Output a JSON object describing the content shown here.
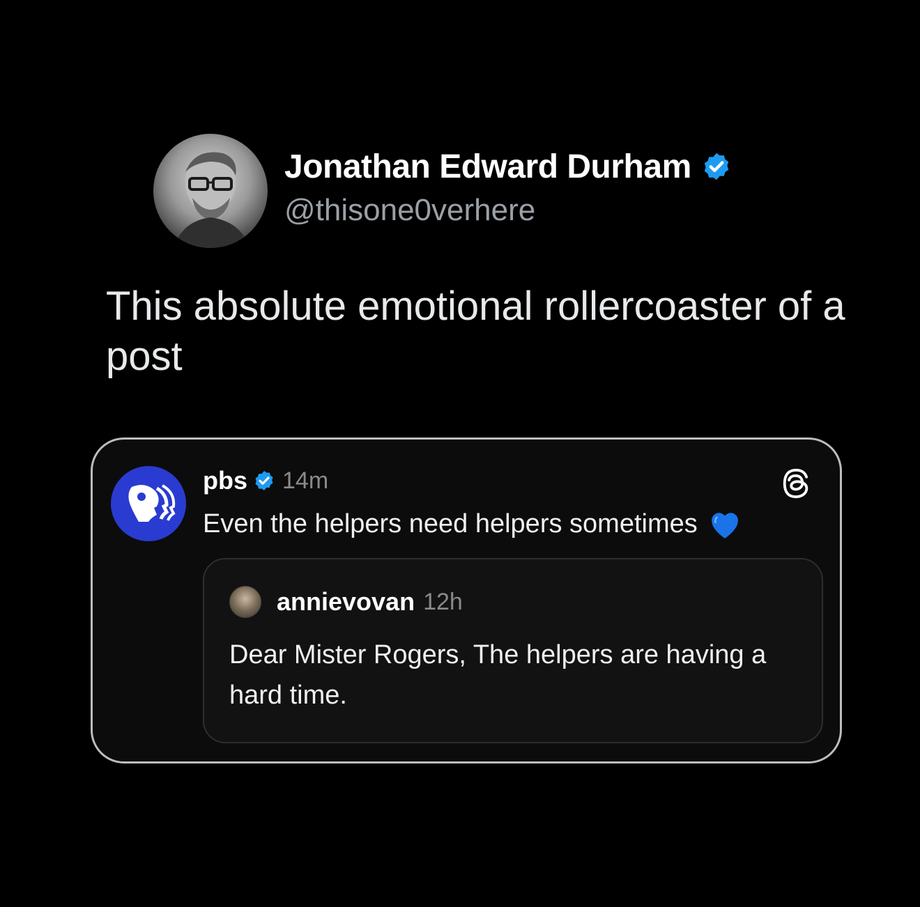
{
  "author": {
    "display_name": "Jonathan Edward Durham",
    "handle": "@thisone0verhere",
    "verified": true,
    "avatar_icon": "portrait-avatar"
  },
  "tweet": {
    "text": "This absolute emotional rollercoaster of a post"
  },
  "embedded_post": {
    "username": "pbs",
    "verified": true,
    "time": "14m",
    "text": "Even the helpers need helpers sometimes",
    "emoji_icon": "blue-heart-icon",
    "platform_icon": "threads-icon",
    "logo_icon": "pbs-logo",
    "quote": {
      "username": "annievovan",
      "time": "12h",
      "text": "Dear Mister Rogers, The helpers are having a hard time."
    }
  },
  "colors": {
    "background": "#000000",
    "verified_blue": "#1d9bf0",
    "pbs_blue": "#2a3bd1",
    "heart_blue": "#1a73e8",
    "card_border": "#bdbdbd"
  }
}
